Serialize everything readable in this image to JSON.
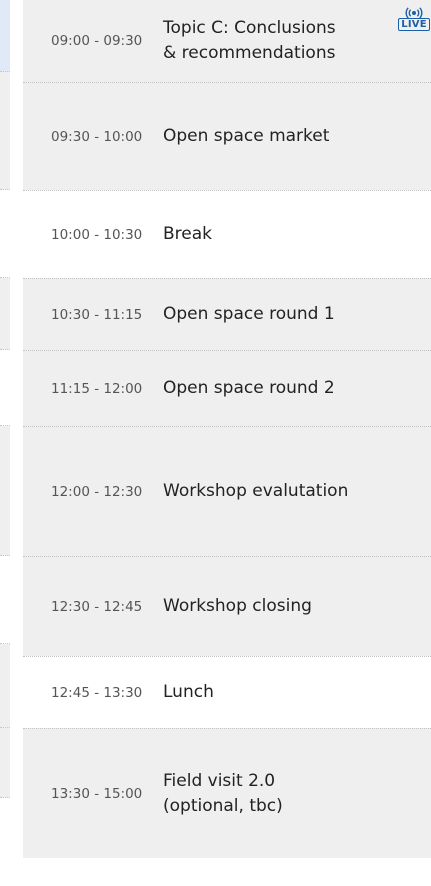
{
  "schedule": {
    "live_label": "LIVE",
    "items": [
      {
        "time": "09:00 - 09:30",
        "title_line1": "Topic C: Conclusions",
        "title_line2": "& recommendations",
        "live": true
      },
      {
        "time": "09:30 - 10:00",
        "title": "Open space market"
      },
      {
        "time": "10:00 - 10:30",
        "title": "Break"
      },
      {
        "time": "10:30 - 11:15",
        "title": "Open space round 1"
      },
      {
        "time": "11:15 - 12:00",
        "title": "Open space round 2"
      },
      {
        "time": "12:00 - 12:30",
        "title": "Workshop evalutation"
      },
      {
        "time": "12:30 - 12:45",
        "title": "Workshop closing"
      },
      {
        "time": "12:45 - 13:30",
        "title": "Lunch"
      },
      {
        "time": "13:30 - 15:00",
        "title_line1": "Field visit 2.0",
        "title_line2": "(optional, tbc)"
      }
    ]
  },
  "colors": {
    "shaded_row": "#efefef",
    "live_blue": "#1a5fa8",
    "selected_left": "#dfeaf6"
  }
}
